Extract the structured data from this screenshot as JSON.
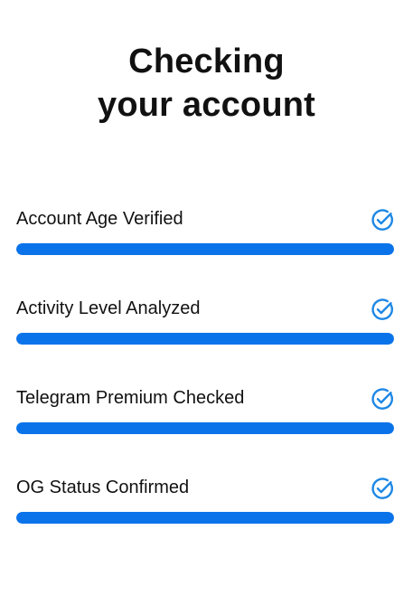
{
  "header": {
    "title_line1": "Checking",
    "title_line2": "your account"
  },
  "checks": [
    {
      "label": "Account Age Verified",
      "status_icon": "check-circle-icon",
      "progress": 1.0
    },
    {
      "label": "Activity Level Analyzed",
      "status_icon": "check-circle-icon",
      "progress": 1.0
    },
    {
      "label": "Telegram Premium Checked",
      "status_icon": "check-circle-icon",
      "progress": 1.0
    },
    {
      "label": "OG Status Confirmed",
      "status_icon": "check-circle-icon",
      "progress": 1.0
    }
  ],
  "colors": {
    "accent": "#0a73ea",
    "icon": "#1e88e5",
    "text": "#111111",
    "background": "#ffffff"
  }
}
